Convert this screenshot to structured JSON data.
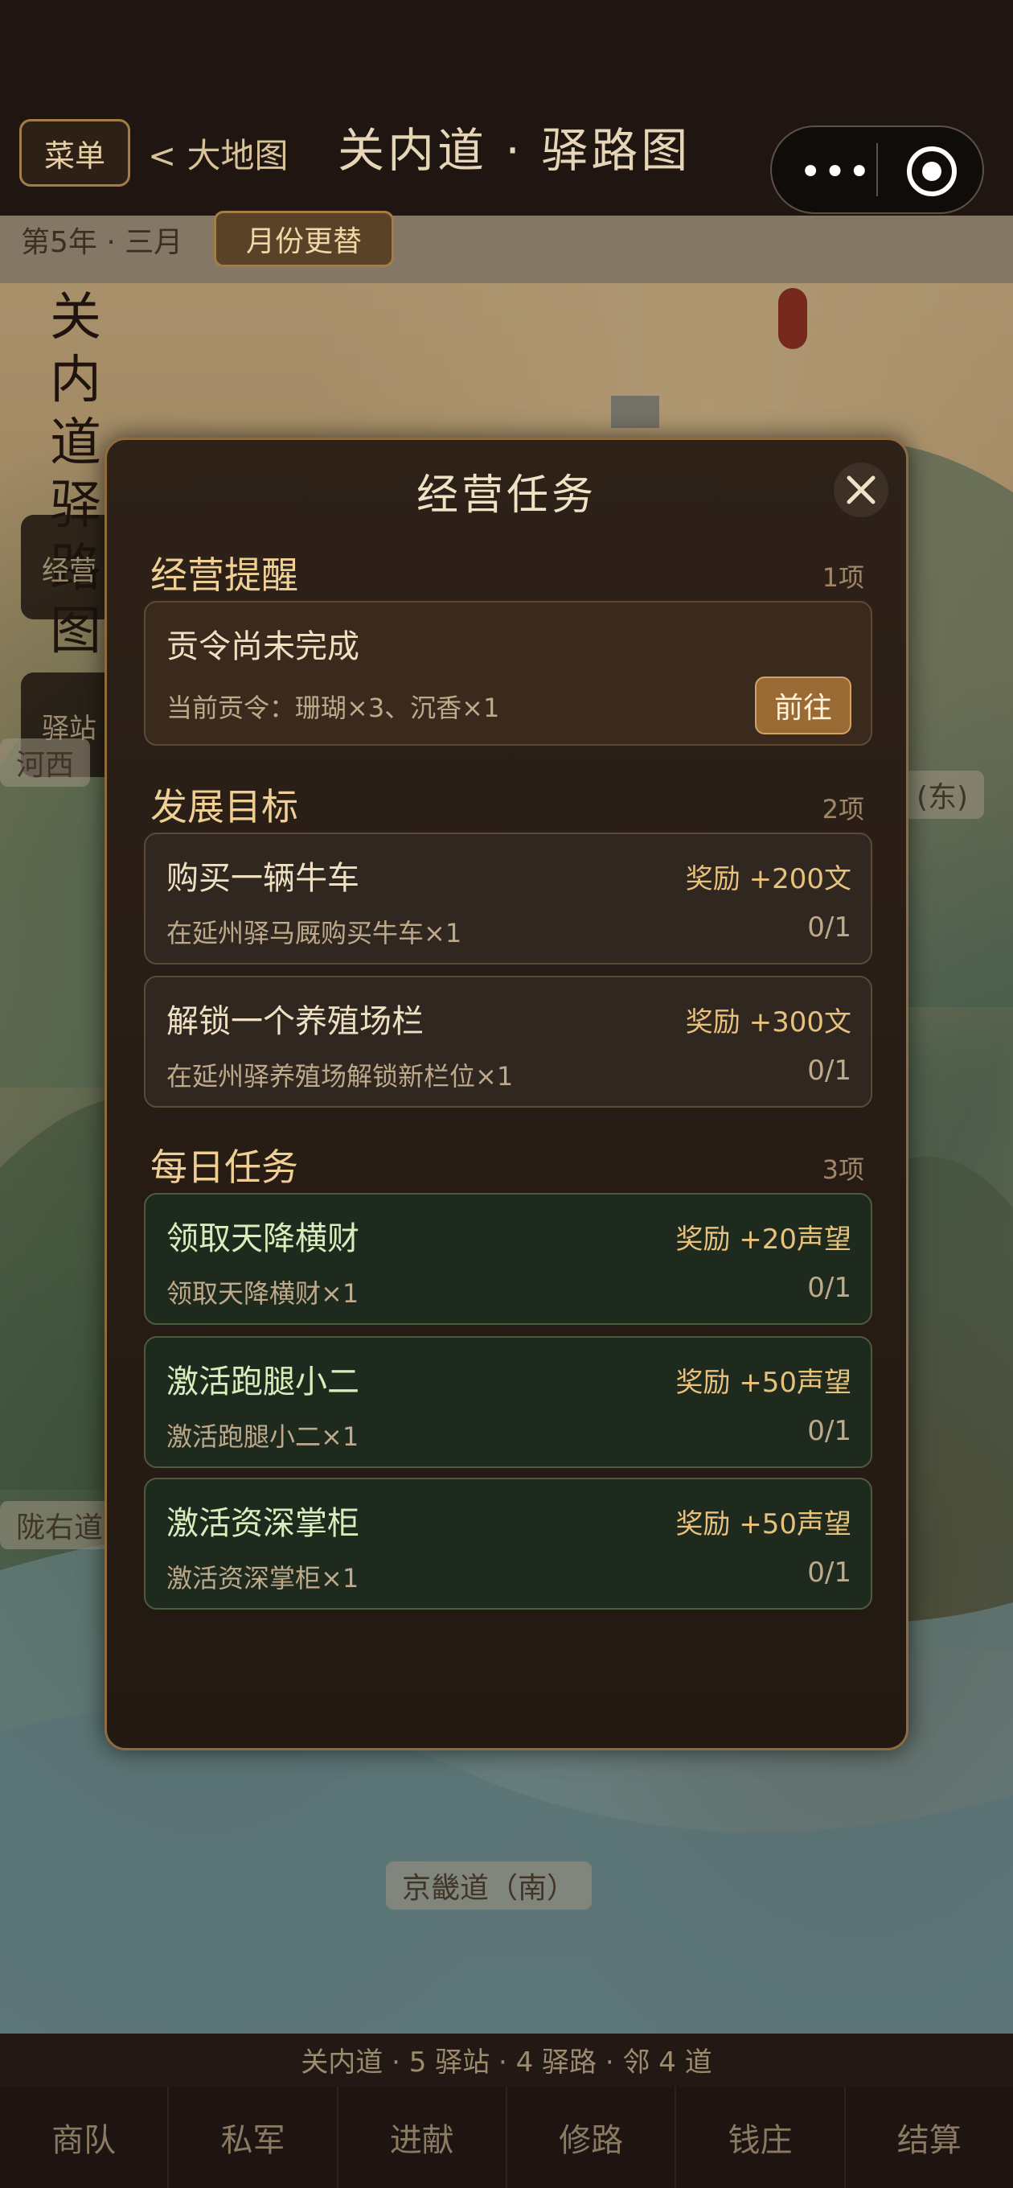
{
  "header": {
    "menu_label": "菜单",
    "back_label": "< 大地图",
    "title": "关内道 · 驿路图"
  },
  "datebar": {
    "date_text": "第5年 · 三月",
    "month_button": "月份更替"
  },
  "map": {
    "title_chars": "关内道驿路图",
    "side_buttons": [
      "经营",
      "驿站"
    ],
    "region_labels": {
      "left_mid": "河西",
      "right_mid": "(东)",
      "left_low": "陇右道",
      "bottom": "京畿道（南）"
    }
  },
  "modal": {
    "title": "经营任务",
    "sections": [
      {
        "title": "经营提醒",
        "count": "1项",
        "cards": [
          {
            "title": "贡令尚未完成",
            "desc": "当前贡令：珊瑚×3、沉香×1",
            "button": "前往"
          }
        ]
      },
      {
        "title": "发展目标",
        "count": "2项",
        "cards": [
          {
            "title": "购买一辆牛车",
            "reward": "奖励 +200文",
            "desc": "在延州驿马厩购买牛车×1",
            "progress": "0/1"
          },
          {
            "title": "解锁一个养殖场栏",
            "reward": "奖励 +300文",
            "desc": "在延州驿养殖场解锁新栏位×1",
            "progress": "0/1"
          }
        ]
      },
      {
        "title": "每日任务",
        "count": "3项",
        "cards": [
          {
            "title": "领取天降横财",
            "reward": "奖励 +20声望",
            "desc": "领取天降横财×1",
            "progress": "0/1"
          },
          {
            "title": "激活跑腿小二",
            "reward": "奖励 +50声望",
            "desc": "激活跑腿小二×1",
            "progress": "0/1"
          },
          {
            "title": "激活资深掌柜",
            "reward": "奖励 +50声望",
            "desc": "激活资深掌柜×1",
            "progress": "0/1"
          }
        ]
      }
    ]
  },
  "footer": {
    "stats": "关内道 · 5 驿站 · 4 驿路 · 邻 4 道",
    "tabs": [
      "商队",
      "私军",
      "进献",
      "修路",
      "钱庄",
      "结算"
    ]
  },
  "colors": {
    "accent": "#efcf93",
    "button": "#9a6a34",
    "daily_card": "#1f2a1e"
  }
}
